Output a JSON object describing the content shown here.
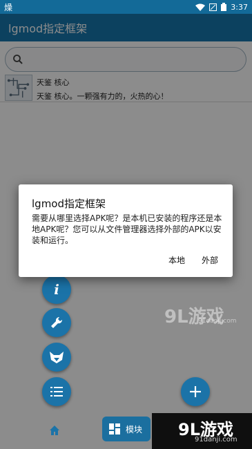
{
  "status_bar": {
    "carrier_glyph": "燥",
    "time": "3:37"
  },
  "app_bar": {
    "title": "lgmod指定框架"
  },
  "search": {
    "placeholder": ""
  },
  "module_list": [
    {
      "title": "天鉴 核心",
      "description": "天鉴 核心。一颗强有力的，火热的心！"
    }
  ],
  "dialog": {
    "title": "lgmod指定框架",
    "message": "需要从哪里选择APK呢？是本机已安装的程序还是本地APK呢？您可以从文件管理器选择外部的APK以安装和运行。",
    "local_button": "本地",
    "external_button": "外部"
  },
  "bottom_nav": {
    "module_tab_label": "模块"
  },
  "watermark": {
    "logo": "9L游戏",
    "url": "91danji.com",
    "faint_logo": "9L游戏",
    "faint_url": "91danji.com"
  },
  "colors": {
    "primary": "#1777ad",
    "status_bar": "#136a98",
    "fab": "#1b73a8"
  },
  "fab_icons": [
    "info-icon",
    "wrench-icon",
    "fox-icon",
    "list-icon",
    "add-icon"
  ]
}
